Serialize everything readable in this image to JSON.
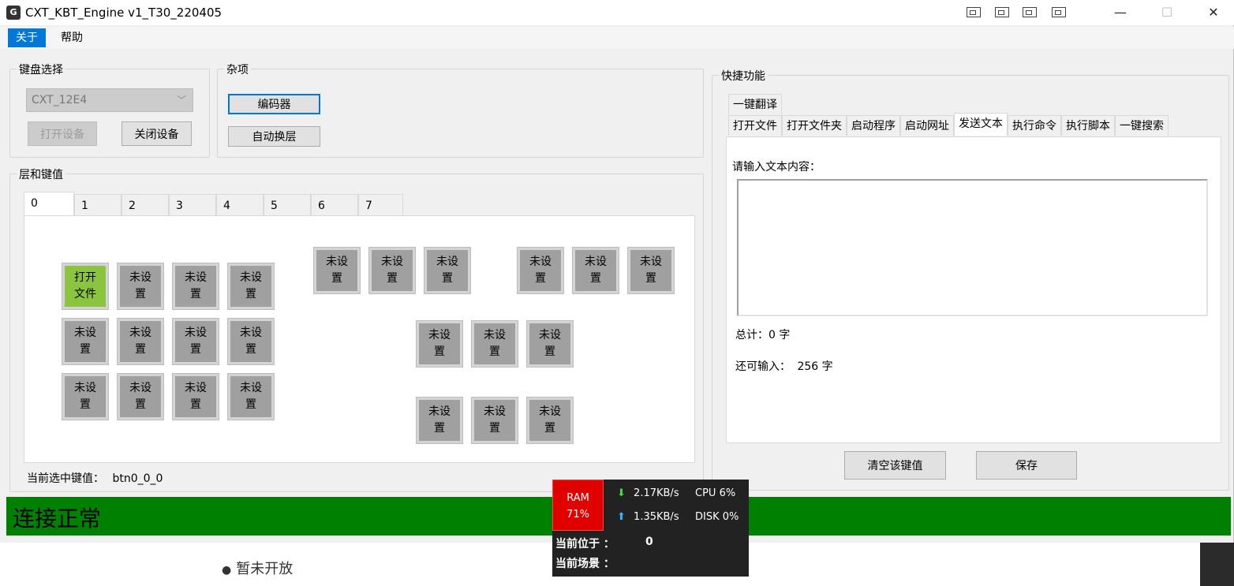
{
  "window": {
    "title": "CXT_KBT_Engine v1_T30_220405",
    "min_label": "—",
    "max_label": "☐",
    "close_label": "✕"
  },
  "menu": {
    "items": [
      "关于",
      "帮助"
    ]
  },
  "keyboard_group": {
    "title": "键盘选择",
    "device_select_value": "CXT_12E4",
    "open_button": "打开设备",
    "close_button": "关闭设备"
  },
  "misc_group": {
    "title": "杂项",
    "encoder_button": "编码器",
    "auto_layer_button": "自动换层"
  },
  "layers_group": {
    "title": "层和键值",
    "tabs": [
      "0",
      "1",
      "2",
      "3",
      "4",
      "5",
      "6",
      "7"
    ],
    "selected_tab": "0",
    "selected_key_label": "当前选中键值：",
    "selected_key_value": "btn0_0_0"
  },
  "keys": {
    "assigned": "打开文件",
    "unset": "未设置"
  },
  "quick_group": {
    "title": "快捷功能",
    "tabs_row1": [
      "一键翻译"
    ],
    "tabs_row2": [
      "打开文件",
      "打开文件夹",
      "启动程序",
      "启动网址",
      "发送文本",
      "执行命令",
      "执行脚本",
      "一键搜索"
    ],
    "selected_tab": "发送文本",
    "prompt": "请输入文本内容：",
    "textarea_value": "",
    "total_label": "总计：0 字",
    "remaining_label": "还可输入：",
    "remaining_value": "256 字",
    "clear_button": "清空该键值",
    "save_button": "保存"
  },
  "status": {
    "text": "连接正常",
    "color": "#008000"
  },
  "monitor": {
    "ram_label": "RAM",
    "ram_value": "71%",
    "download": "2.17KB/s",
    "upload": "1.35KB/s",
    "cpu": "CPU 6%",
    "disk": "DISK 0%",
    "position_label": "当前位于 ：",
    "position_value": "0",
    "scene_label": "当前场景 ："
  },
  "background_page": {
    "bullet_text": "暂未开放"
  }
}
